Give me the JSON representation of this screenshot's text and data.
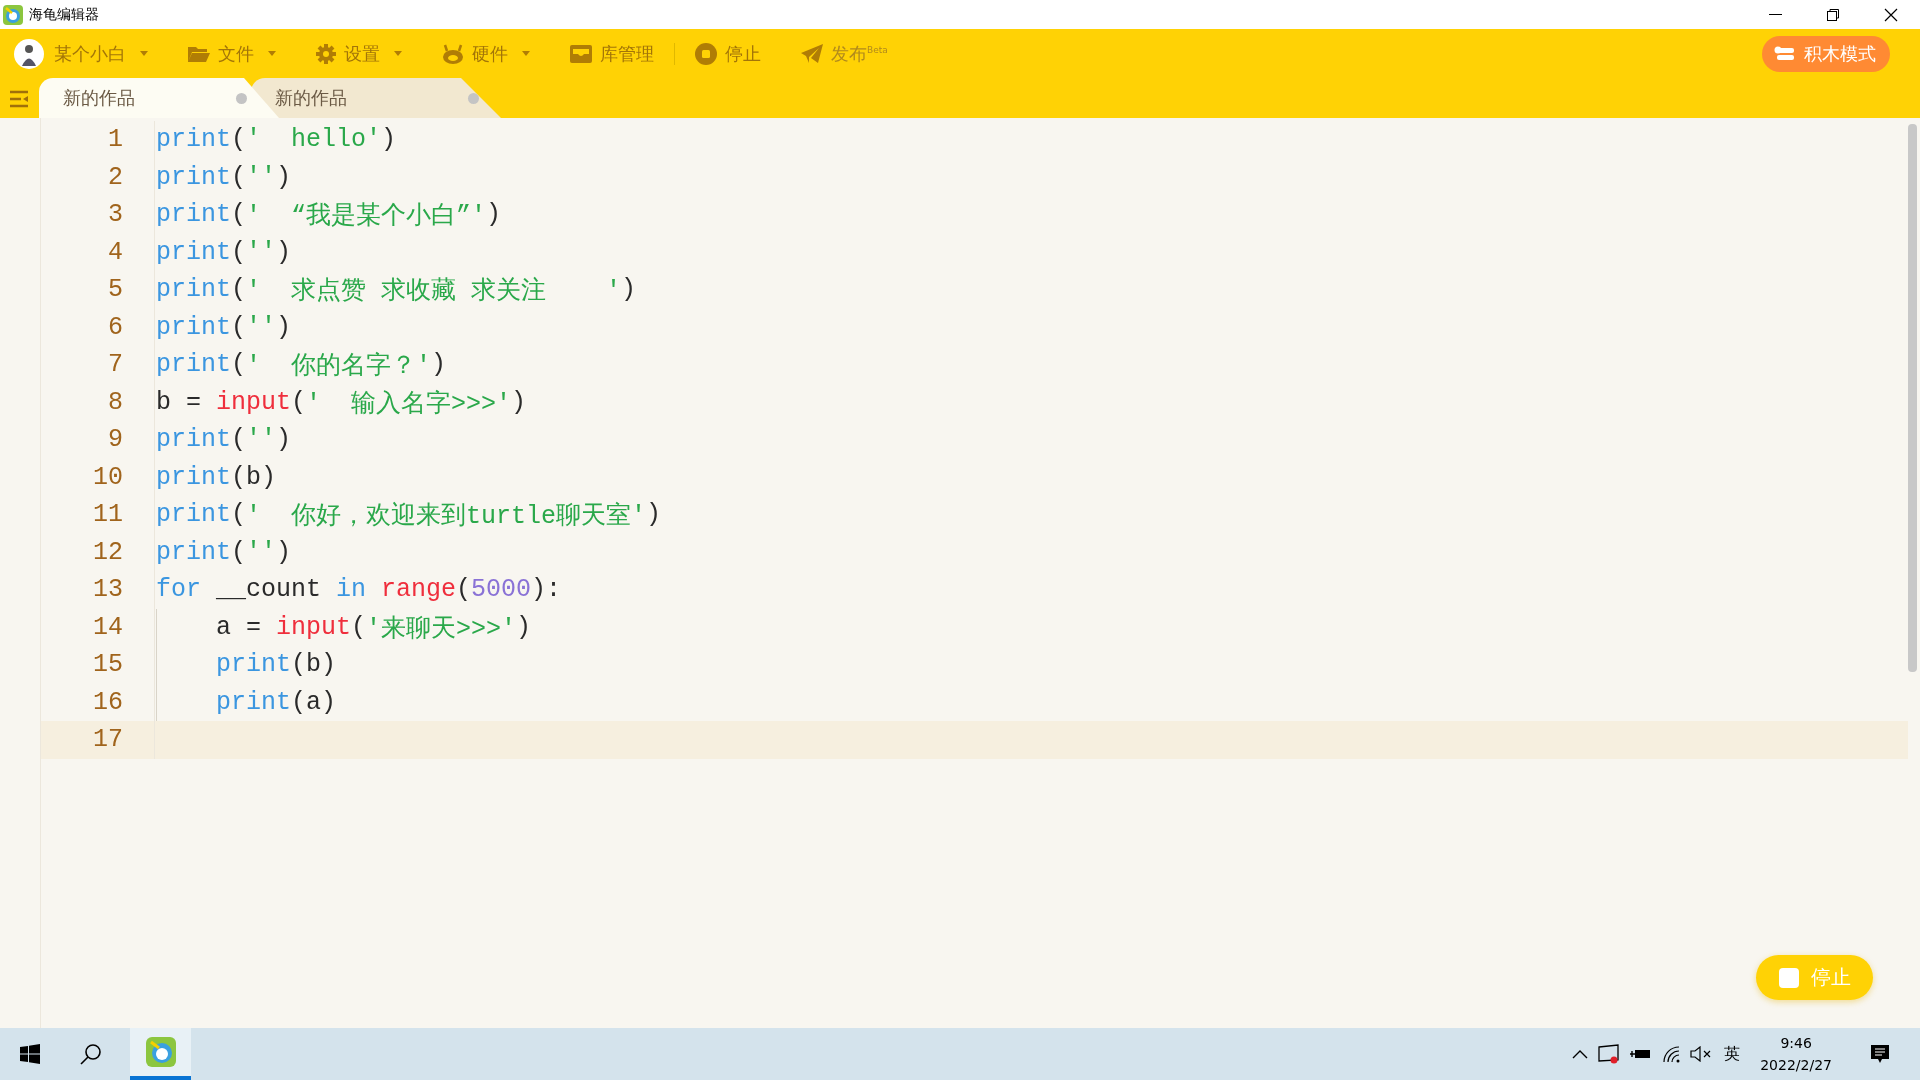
{
  "window": {
    "title": "海龟编辑器"
  },
  "toolbar": {
    "items": [
      {
        "label": "某个小白",
        "has_menu": true
      },
      {
        "label": "文件",
        "has_menu": true
      },
      {
        "label": "设置",
        "has_menu": true
      },
      {
        "label": "硬件",
        "has_menu": true
      },
      {
        "label": "库管理",
        "has_menu": false
      },
      {
        "label": "停止",
        "has_menu": false
      },
      {
        "label": "发布$^{Beta}$",
        "has_menu": false
      }
    ],
    "mode_button": "积木模式"
  },
  "tabs": [
    {
      "label": "新的作品",
      "selected": true
    },
    {
      "label": "新的作品",
      "selected": false
    }
  ],
  "editor": {
    "lines": [
      {
        "number": "1",
        "indent": false,
        "current": false,
        "tokens": [
          {
            "kind": "fn",
            "text": "print"
          },
          {
            "kind": "plain",
            "text": "("
          },
          {
            "kind": "str",
            "text": "'  hello'"
          },
          {
            "kind": "plain",
            "text": ")"
          }
        ]
      },
      {
        "number": "2",
        "indent": false,
        "current": false,
        "tokens": [
          {
            "kind": "fn",
            "text": "print"
          },
          {
            "kind": "plain",
            "text": "("
          },
          {
            "kind": "str",
            "text": "''"
          },
          {
            "kind": "plain",
            "text": ")"
          }
        ]
      },
      {
        "number": "3",
        "indent": false,
        "current": false,
        "tokens": [
          {
            "kind": "fn",
            "text": "print"
          },
          {
            "kind": "plain",
            "text": "("
          },
          {
            "kind": "str",
            "text": "'  “我是某个小白”'"
          },
          {
            "kind": "plain",
            "text": ")"
          }
        ]
      },
      {
        "number": "4",
        "indent": false,
        "current": false,
        "tokens": [
          {
            "kind": "fn",
            "text": "print"
          },
          {
            "kind": "plain",
            "text": "("
          },
          {
            "kind": "str",
            "text": "''"
          },
          {
            "kind": "plain",
            "text": ")"
          }
        ]
      },
      {
        "number": "5",
        "indent": false,
        "current": false,
        "tokens": [
          {
            "kind": "fn",
            "text": "print"
          },
          {
            "kind": "plain",
            "text": "("
          },
          {
            "kind": "str",
            "text": "'  求点赞 求收藏 求关注    '"
          },
          {
            "kind": "plain",
            "text": ")"
          }
        ]
      },
      {
        "number": "6",
        "indent": false,
        "current": false,
        "tokens": [
          {
            "kind": "fn",
            "text": "print"
          },
          {
            "kind": "plain",
            "text": "("
          },
          {
            "kind": "str",
            "text": "''"
          },
          {
            "kind": "plain",
            "text": ")"
          }
        ]
      },
      {
        "number": "7",
        "indent": false,
        "current": false,
        "tokens": [
          {
            "kind": "fn",
            "text": "print"
          },
          {
            "kind": "plain",
            "text": "("
          },
          {
            "kind": "str",
            "text": "'  你的名字？'"
          },
          {
            "kind": "plain",
            "text": ")"
          }
        ]
      },
      {
        "number": "8",
        "indent": false,
        "current": false,
        "tokens": [
          {
            "kind": "plain",
            "text": "b = "
          },
          {
            "kind": "builtin",
            "text": "input"
          },
          {
            "kind": "plain",
            "text": "("
          },
          {
            "kind": "str",
            "text": "'  输入名字>>>'"
          },
          {
            "kind": "plain",
            "text": ")"
          }
        ]
      },
      {
        "number": "9",
        "indent": false,
        "current": false,
        "tokens": [
          {
            "kind": "fn",
            "text": "print"
          },
          {
            "kind": "plain",
            "text": "("
          },
          {
            "kind": "str",
            "text": "''"
          },
          {
            "kind": "plain",
            "text": ")"
          }
        ]
      },
      {
        "number": "10",
        "indent": false,
        "current": false,
        "tokens": [
          {
            "kind": "fn",
            "text": "print"
          },
          {
            "kind": "plain",
            "text": "(b)"
          }
        ]
      },
      {
        "number": "11",
        "indent": false,
        "current": false,
        "tokens": [
          {
            "kind": "fn",
            "text": "print"
          },
          {
            "kind": "plain",
            "text": "("
          },
          {
            "kind": "str",
            "text": "'  你好，欢迎来到turtle聊天室'"
          },
          {
            "kind": "plain",
            "text": ")"
          }
        ]
      },
      {
        "number": "12",
        "indent": false,
        "current": false,
        "tokens": [
          {
            "kind": "fn",
            "text": "print"
          },
          {
            "kind": "plain",
            "text": "("
          },
          {
            "kind": "str",
            "text": "''"
          },
          {
            "kind": "plain",
            "text": ")"
          }
        ]
      },
      {
        "number": "13",
        "indent": false,
        "current": false,
        "tokens": [
          {
            "kind": "kw",
            "text": "for"
          },
          {
            "kind": "plain",
            "text": " __count "
          },
          {
            "kind": "kw",
            "text": "in"
          },
          {
            "kind": "builtin",
            "text": " range"
          },
          {
            "kind": "plain",
            "text": "("
          },
          {
            "kind": "num",
            "text": "5000"
          },
          {
            "kind": "plain",
            "text": "):"
          }
        ]
      },
      {
        "number": "14",
        "indent": true,
        "current": false,
        "tokens": [
          {
            "kind": "plain",
            "text": "a = "
          },
          {
            "kind": "builtin",
            "text": "input"
          },
          {
            "kind": "plain",
            "text": "("
          },
          {
            "kind": "str",
            "text": "'来聊天>>>'"
          },
          {
            "kind": "plain",
            "text": ")"
          }
        ]
      },
      {
        "number": "15",
        "indent": true,
        "current": false,
        "tokens": [
          {
            "kind": "fn",
            "text": "print"
          },
          {
            "kind": "plain",
            "text": "(b)"
          }
        ]
      },
      {
        "number": "16",
        "indent": true,
        "current": false,
        "tokens": [
          {
            "kind": "fn",
            "text": "print"
          },
          {
            "kind": "plain",
            "text": "(a)"
          }
        ]
      },
      {
        "number": "17",
        "current": true
      }
    ]
  },
  "stop_button": "停止",
  "taskbar": {
    "input_method": "英",
    "time": "9:46",
    "date": "2022/2/27"
  }
}
